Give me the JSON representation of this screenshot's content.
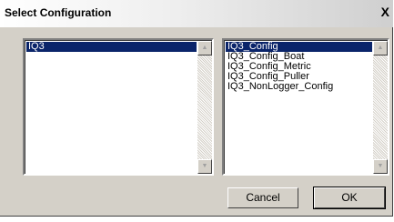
{
  "dialog": {
    "title": "Select Configuration",
    "close_glyph": "X"
  },
  "left_list": {
    "items": [
      "IQ3"
    ]
  },
  "right_list": {
    "items": [
      "IQ3_Config",
      "IQ3_Config_Boat",
      "IQ3_Config_Metric",
      "IQ3_Config_Puller",
      "IQ3_NonLogger_Config"
    ]
  },
  "scroll_icons": {
    "up": "▲",
    "down": "▼"
  },
  "buttons": {
    "cancel": "Cancel",
    "ok": "OK"
  }
}
